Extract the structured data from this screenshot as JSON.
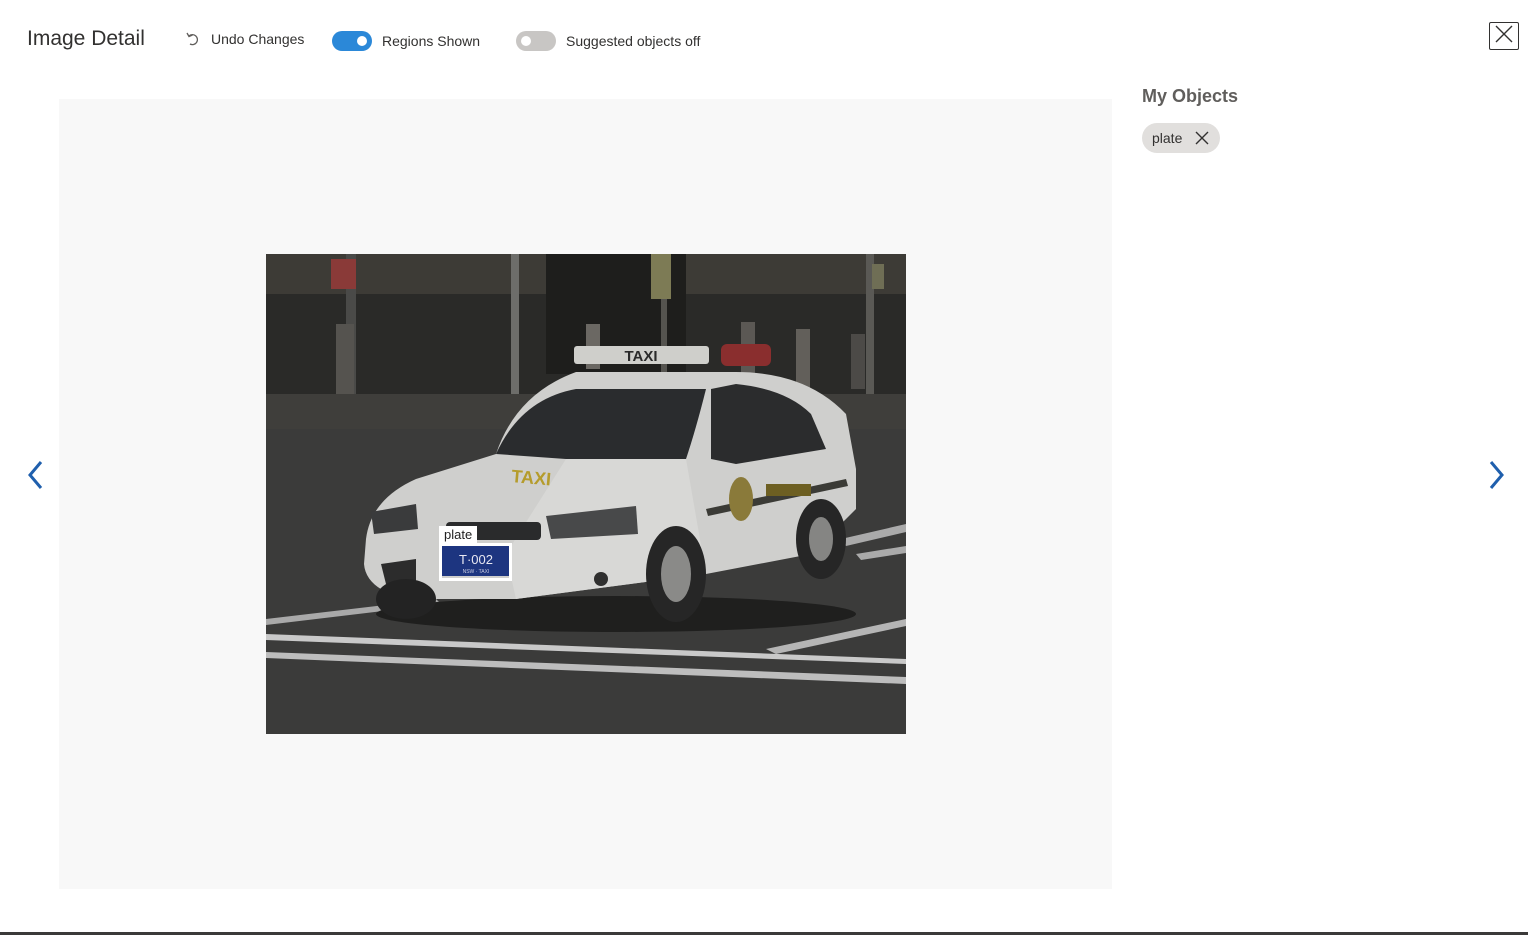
{
  "header": {
    "title": "Image Detail",
    "undo_label": "Undo Changes",
    "undo_icon": "undo-icon",
    "regions_toggle": {
      "label": "Regions Shown",
      "on": true
    },
    "suggested_toggle": {
      "label": "Suggested objects off",
      "on": false
    },
    "close_icon": "close-icon"
  },
  "canvas": {
    "image": {
      "region": {
        "tag": "plate"
      },
      "plate_text": "T·002",
      "plate_sub": "NSW · TAXI",
      "roof_sign": "TAXI",
      "side_text": "TAXI"
    }
  },
  "navigation": {
    "prev_icon": "chevron-left-icon",
    "next_icon": "chevron-right-icon"
  },
  "panel": {
    "title": "My Objects",
    "tags": [
      {
        "label": "plate"
      }
    ]
  },
  "colors": {
    "accent": "#2b88d8",
    "nav": "#1f5fad",
    "chip_bg": "#e1dfdd"
  }
}
